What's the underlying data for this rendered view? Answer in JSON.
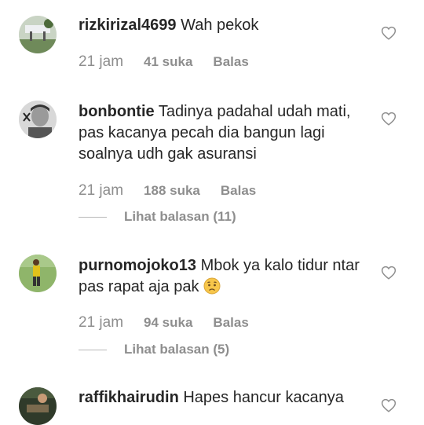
{
  "comments": [
    {
      "username": "rizkirizal4699",
      "text": "Wah pekok",
      "time": "21 jam",
      "likes": "41 suka",
      "reply": "Balas"
    },
    {
      "username": "bonbontie",
      "text": "Tadinya padahal udah mati, pas kacanya pecah dia bangun lagi soalnya udh gak asuransi",
      "time": "21 jam",
      "likes": "188 suka",
      "reply": "Balas",
      "view_replies": "Lihat balasan (11)"
    },
    {
      "username": "purnomojoko13",
      "text": "Mbok ya kalo tidur ntar pas rapat aja pak",
      "emoji": "worried-face-icon",
      "time": "21 jam",
      "likes": "94 suka",
      "reply": "Balas",
      "view_replies": "Lihat balasan (5)"
    },
    {
      "username": "raffikhairudin",
      "text": "Hapes hancur kacanya"
    }
  ],
  "colors": {
    "text": "#262626",
    "secondary": "#8e8e8e",
    "divider": "#b8b8b8",
    "background": "#ffffff"
  }
}
